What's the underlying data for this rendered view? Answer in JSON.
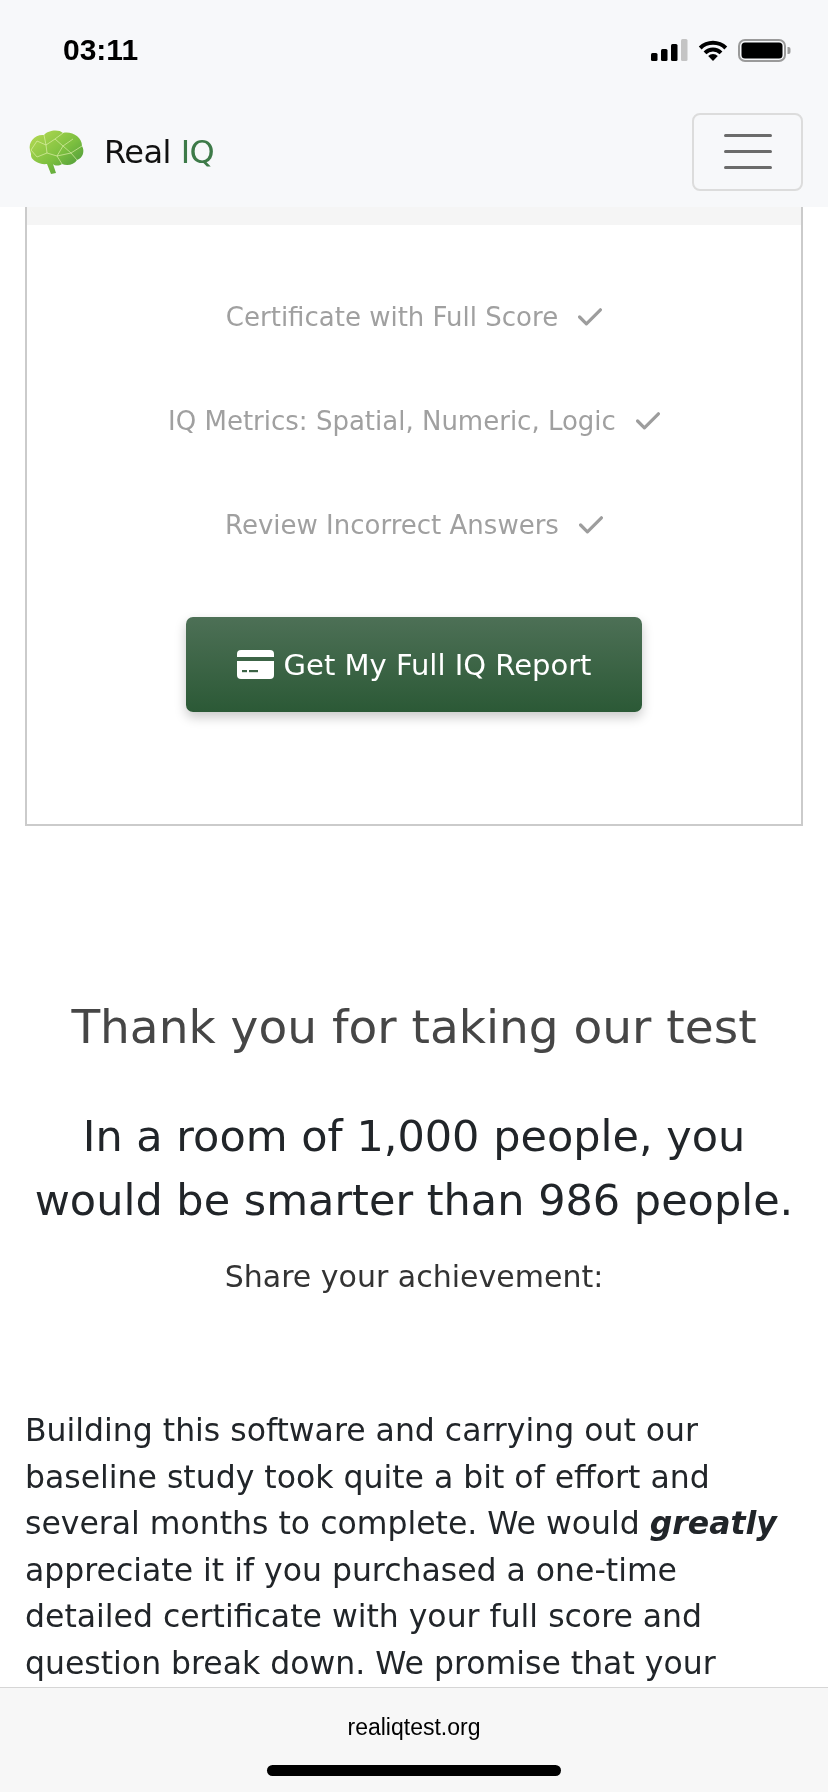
{
  "status_bar": {
    "time": "03:11"
  },
  "navbar": {
    "brand": [
      {
        "text": "Real",
        "accent": false
      },
      {
        "text": "IQ",
        "accent": true
      }
    ]
  },
  "card": {
    "features": [
      {
        "label": "Certificate with Full Score",
        "checked": true
      },
      {
        "label": "IQ Metrics: Spatial, Numeric, Logic",
        "checked": true
      },
      {
        "label": "Review Incorrect Answers",
        "checked": true
      }
    ],
    "button": {
      "label": "Get My Full IQ Report"
    }
  },
  "result": {
    "title": "Thank you for taking our test",
    "headline": "In a room of 1,000 people, you would be smarter than 986 people.",
    "share_label": "Share your achievement:"
  },
  "appeal": {
    "text": "Building this software and carrying out our baseline study took quite a bit of effort and several months to complete. We would **greatly** appreciate it if you purchased a one-time detailed certificate with your full score and question break down. We promise that your"
  },
  "browser_bar": {
    "url": "realiqtest.org"
  }
}
